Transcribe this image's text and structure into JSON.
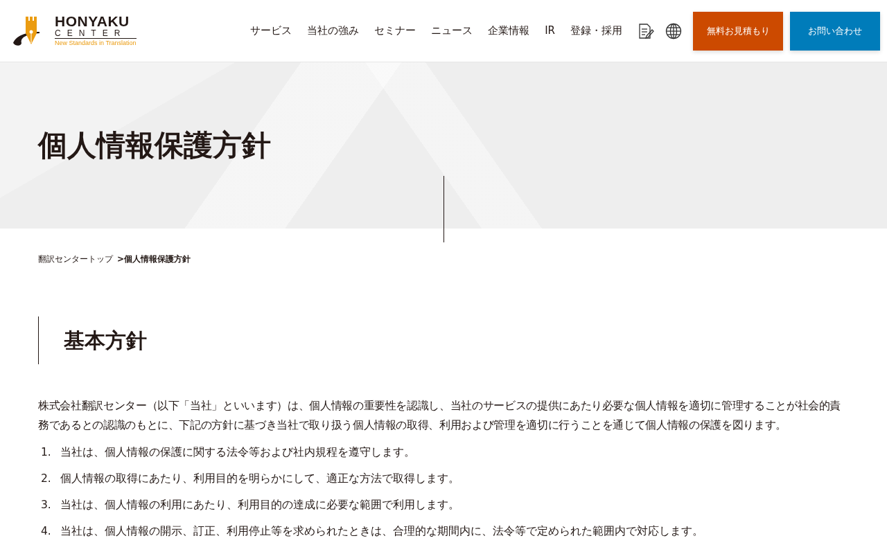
{
  "logo": {
    "name": "HONYAKU",
    "subname": "CENTER",
    "tagline": "New Standards in Translation"
  },
  "nav": [
    "サービス",
    "当社の強み",
    "セミナー",
    "ニュース",
    "企業情報",
    "IR",
    "登録・採用"
  ],
  "header_buttons": [
    {
      "label": "無料お見積もり",
      "color": "#cc4a00"
    },
    {
      "label": "お問い合わせ",
      "color": "#007cba"
    }
  ],
  "hero": {
    "title": "個人情報保護方針"
  },
  "breadcrumb": [
    {
      "label": "翻訳センタートップ",
      "current": false
    },
    {
      "label": ">個人情報保護方針",
      "current": true
    }
  ],
  "section": {
    "heading": "基本方針",
    "intro": "株式会社翻訳センター（以下「当社」といいます）は、個人情報の重要性を認識し、当社のサービスの提供にあたり必要な個人情報を適切に管理することが社会的責務であるとの認識のもとに、下記の方針に基づき当社で取り扱う個人情報の取得、利用および管理を適切に行うことを通じて個人情報の保護を図ります。",
    "items": [
      {
        "number": "1.",
        "text": "当社は、個人情報の保護に関する法令等および社内規程を遵守します。"
      },
      {
        "number": "2.",
        "text": "個人情報の取得にあたり、利用目的を明らかにして、適正な方法で取得します。"
      },
      {
        "number": "3.",
        "text": "当社は、個人情報の利用にあたり、利用目的の達成に必要な範囲で利用します。"
      },
      {
        "number": "4.",
        "text": "当社は、個人情報の開示、訂正、利用停止等を求められたときは、合理的な期間内に、法令等で定められた範囲内で対応します。"
      }
    ]
  }
}
